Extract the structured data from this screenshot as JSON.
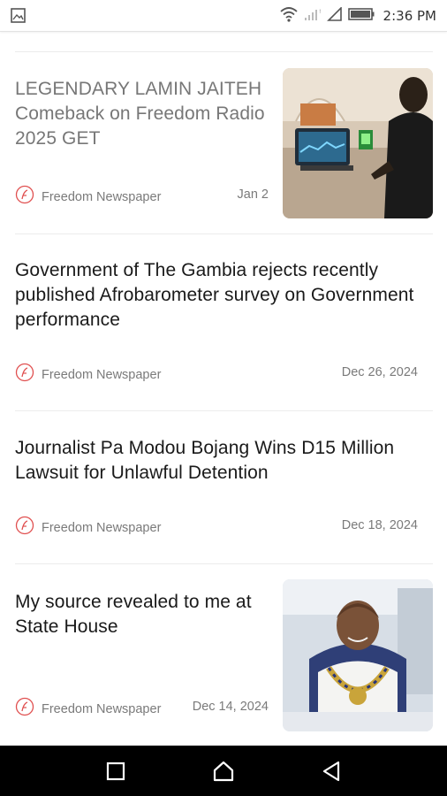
{
  "status_bar": {
    "time": "2:36 PM",
    "icons": [
      "image-notification-icon",
      "wifi-icon",
      "cell-signal-icon",
      "cell-signal-empty-icon",
      "battery-icon"
    ]
  },
  "articles": [
    {
      "title": "LEGENDARY LAMIN JAITEH  Comeback on Freedom Radio 2025 GET",
      "source": "Freedom Newspaper",
      "date": "Jan 2",
      "has_thumbnail": true,
      "read": true
    },
    {
      "title": "Government of The Gambia rejects recently published Afrobarometer survey on Government performance",
      "source": "Freedom Newspaper",
      "date": "Dec 26, 2024",
      "has_thumbnail": false,
      "read": false
    },
    {
      "title": "Journalist Pa Modou Bojang Wins D15 Million Lawsuit for Unlawful Detention",
      "source": "Freedom Newspaper",
      "date": "Dec 18, 2024",
      "has_thumbnail": false,
      "read": false
    },
    {
      "title": "My source revealed to me at State House",
      "source": "Freedom Newspaper",
      "date": "Dec 14, 2024",
      "has_thumbnail": true,
      "read": false
    }
  ],
  "nav_bar": {
    "buttons": [
      "recents-square-icon",
      "home-icon",
      "back-triangle-icon"
    ]
  },
  "colors": {
    "title": "#1a1a1a",
    "title_read": "#777777",
    "meta": "#7a7a7a",
    "source_icon": "#e05050",
    "navbar": "#000000"
  }
}
